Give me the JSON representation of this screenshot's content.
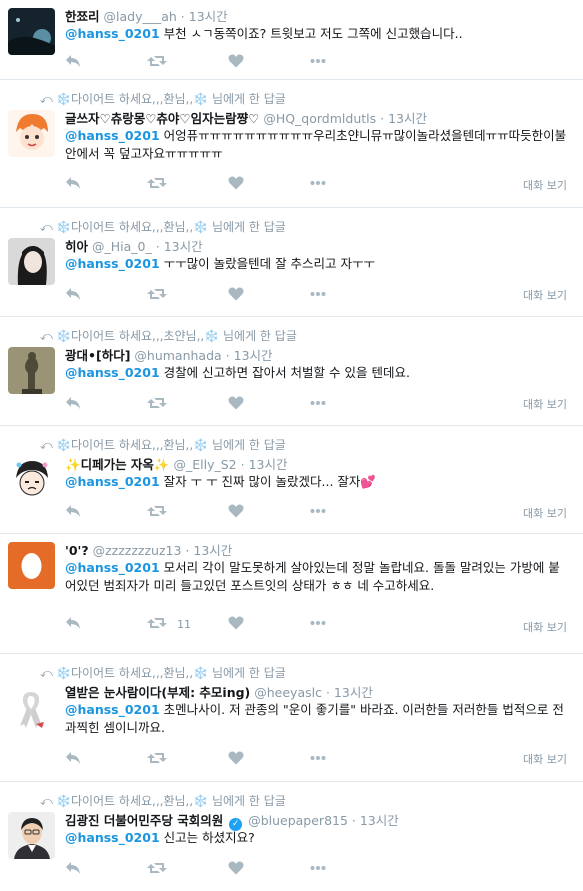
{
  "icons": {
    "reply": "reply-icon",
    "retweet": "retweet-icon",
    "like": "heart-icon",
    "more": "more-icon",
    "in_reply_to": "reply-arrow-icon",
    "verified": "verified-badge-icon"
  },
  "colors": {
    "mention": "#1b95e0",
    "meta": "#8899a6",
    "action": "#aab8c2",
    "divider": "#e1e8ed"
  },
  "tweets": [
    {
      "context": "",
      "name": "한쬬리",
      "handle": "@lady___ah",
      "sep": "·",
      "time": "13시간",
      "mention": "@hanss_0201",
      "text": " 부천 ㅅㄱ동쪽이죠? 트윗보고 저도 그쪽에 신고했습니다..",
      "retweets": "",
      "show_conv": ""
    },
    {
      "context": "❄️다이어트 하세요,,,환님,,❄️ 님에게 한 답글",
      "name": "글쓰자♡츄랑몽♡츄야♡임자는람쨩♡",
      "handle": "@HQ_qordmldutls",
      "sep": "·",
      "time": "13시간",
      "mention": "@hanss_0201",
      "text": " 어엉퓨ㅠㅠㅠㅠㅠㅠㅠㅠㅠㅠ우리초얀니뮤ㅠ많이놀라셨을텐데ㅠㅠ따듯한이불안에서 꼭 덮고자요ㅠㅠㅠㅠㅠ",
      "retweets": "",
      "show_conv": "대화 보기"
    },
    {
      "context": "❄️다이어트 하세요,,,환님,,❄️ 님에게 한 답글",
      "name": "히아",
      "handle": "@_Hia_0_",
      "sep": "·",
      "time": "13시간",
      "mention": "@hanss_0201",
      "text": " ㅜㅜ많이 놀랐을텐데 잘 추스리고 자ㅜㅜ",
      "retweets": "",
      "show_conv": "대화 보기"
    },
    {
      "context": "❄️다이어트 하세요,,,초얀님,,❄️ 님에게 한 답글",
      "name": "광대•[하다]",
      "handle": "@humanhada",
      "sep": "·",
      "time": "13시간",
      "mention": "@hanss_0201",
      "text": " 경찰에 신고하면 잡아서 처벌할 수 있을 텐데요.",
      "retweets": "",
      "show_conv": "대화 보기"
    },
    {
      "context": "❄️다이어트 하세요,,,환님,,❄️ 님에게 한 답글",
      "name": "✨디페가는 자옥✨",
      "handle": "@_Elly_S2",
      "sep": "·",
      "time": "13시간",
      "mention": "@hanss_0201",
      "text": " 잘자 ㅜ ㅜ 진짜 많이 놀랐겠다... 잘자💕",
      "retweets": "",
      "show_conv": "대화 보기"
    },
    {
      "context": "",
      "name": "'0'?",
      "handle": "@zzzzzzzuz13",
      "sep": "·",
      "time": "13시간",
      "mention": "@hanss_0201",
      "text": " 모서리 각이 말도못하게 살아있는데 정말 놀랍네요. 돌돌 말려있는 가방에 붙어있던 범죄자가 미리 들고있던 포스트잇의 상태가 ㅎㅎ 네 수고하세요.",
      "retweets": "11",
      "show_conv": "대화 보기"
    },
    {
      "context": "❄️다이어트 하세요,,,환님,,❄️ 님에게 한 답글",
      "name": "열받은 눈사람이다(부제: 추모ing)",
      "handle": "@heeyaslc",
      "sep": "·",
      "time": "13시간",
      "mention": "@hanss_0201",
      "text": " 초멘나사이. 저 관종의 \"운이 좋기를\" 바라죠. 이러한들 저러한들 법적으로 전과찍힌 셈이니까요.",
      "retweets": "",
      "show_conv": "대화 보기"
    },
    {
      "context": "❄️다이어트 하세요,,,환님,,❄️ 님에게 한 답글",
      "name": "김광진 더불어민주당 국회의원",
      "handle": "@bluepaper815",
      "sep": "·",
      "time": "13시간",
      "mention": "@hanss_0201",
      "text": " 신고는 하셨지요?",
      "retweets": "",
      "show_conv": ""
    }
  ]
}
